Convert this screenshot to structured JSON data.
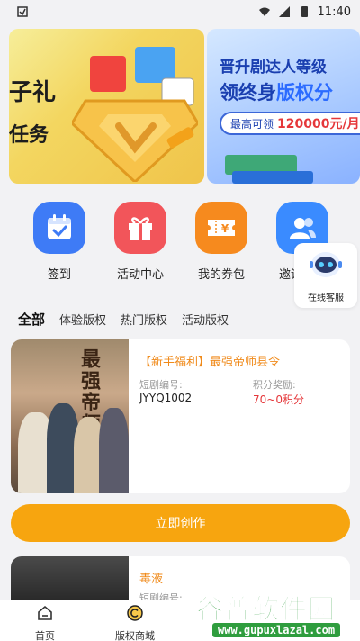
{
  "status_bar": {
    "time": "11:40"
  },
  "banners": [
    {
      "text_line1": "子礼",
      "text_line2": "任务"
    },
    {
      "title": "晋升剧达人等级",
      "subtitle_prefix": "领终身",
      "subtitle_highlight": "版权分",
      "pill_label": "最高可领",
      "pill_value": "120000元/月"
    }
  ],
  "quick_actions": [
    {
      "label": "签到",
      "icon": "calendar-check-icon",
      "color": "#3e7bf6"
    },
    {
      "label": "活动中心",
      "icon": "gift-icon",
      "color": "#f2555a"
    },
    {
      "label": "我的券包",
      "icon": "coupon-icon",
      "color": "#f68a1e"
    },
    {
      "label": "邀请好友",
      "icon": "users-icon",
      "color": "#3a8bff"
    }
  ],
  "float_service": {
    "label": "在线客服"
  },
  "tabs": [
    {
      "label": "全部",
      "active": true
    },
    {
      "label": "体验版权",
      "active": false
    },
    {
      "label": "热门版权",
      "active": false
    },
    {
      "label": "活动版权",
      "active": false
    }
  ],
  "cards": [
    {
      "title": "【新手福利】最强帝师县令",
      "code_label": "短剧编号:",
      "points_label": "积分奖励:",
      "code": "JYYQ1002",
      "points": "70~0积分",
      "poster_text": "最强帝师县令"
    },
    {
      "title": "毒液",
      "code_label": "短剧编号:",
      "points_label": "",
      "code": "",
      "points": ""
    }
  ],
  "create_button": {
    "label": "立即创作"
  },
  "bottom_nav": [
    {
      "label": "首页",
      "icon": "home-icon"
    },
    {
      "label": "版权商城",
      "icon": "copyright-icon"
    }
  ],
  "watermark": {
    "main": "谷普软件园",
    "sub": "www.gupuxlazal.com"
  }
}
